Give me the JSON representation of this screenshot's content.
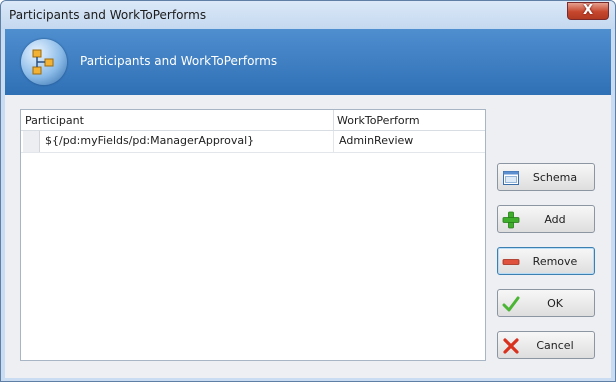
{
  "window": {
    "title": "Participants and WorkToPerforms",
    "close_label": "X"
  },
  "header": {
    "title": "Participants and WorkToPerforms",
    "icon": "workflow-diagram-icon"
  },
  "table": {
    "columns": [
      "Participant",
      "WorkToPerform"
    ],
    "rows": [
      {
        "participant": "${/pd:myFields/pd:ManagerApproval}",
        "work": "AdminReview"
      }
    ]
  },
  "buttons": {
    "schema": {
      "label": "Schema",
      "icon": "schema-window-icon"
    },
    "add": {
      "label": "Add",
      "icon": "plus-icon"
    },
    "remove": {
      "label": "Remove",
      "icon": "minus-icon"
    },
    "ok": {
      "label": "OK",
      "icon": "checkmark-icon"
    },
    "cancel": {
      "label": "Cancel",
      "icon": "red-x-icon"
    }
  }
}
